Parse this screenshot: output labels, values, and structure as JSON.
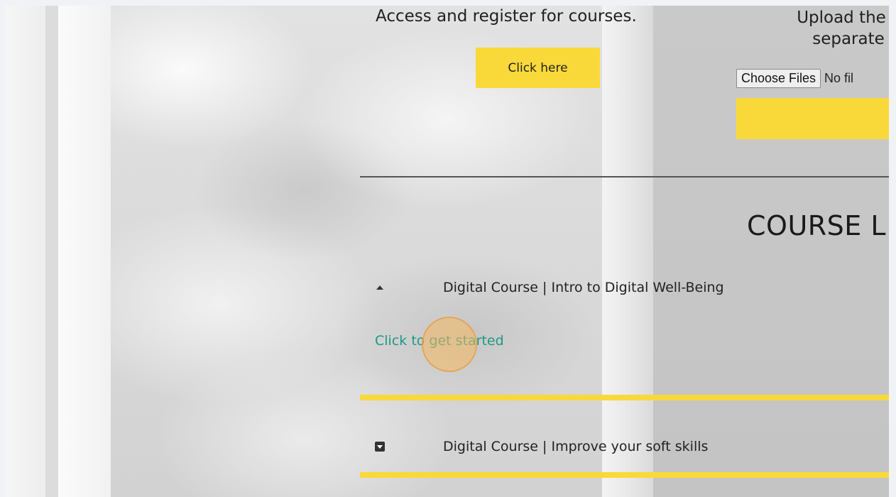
{
  "register": {
    "heading": "Access and register for courses.",
    "button_label": "Click here"
  },
  "upload": {
    "heading_line1": "Upload the c",
    "heading_line2": "separate",
    "choose_button": "Choose Files",
    "file_status": "No fil"
  },
  "course_list": {
    "heading": "COURSE L",
    "items": [
      {
        "title": "Digital Course | Intro to Digital Well-Being",
        "state": "expanded",
        "link_text": "Click to get started"
      },
      {
        "title": "Digital Course | Improve your soft skills",
        "state": "collapsed"
      }
    ]
  },
  "colors": {
    "accent_yellow": "#f9d93a",
    "link_teal": "#1c9a86",
    "click_indicator": "#f7b860"
  },
  "icons": {
    "expanded": "caret-up-icon",
    "collapsed": "caret-down-box-icon"
  }
}
